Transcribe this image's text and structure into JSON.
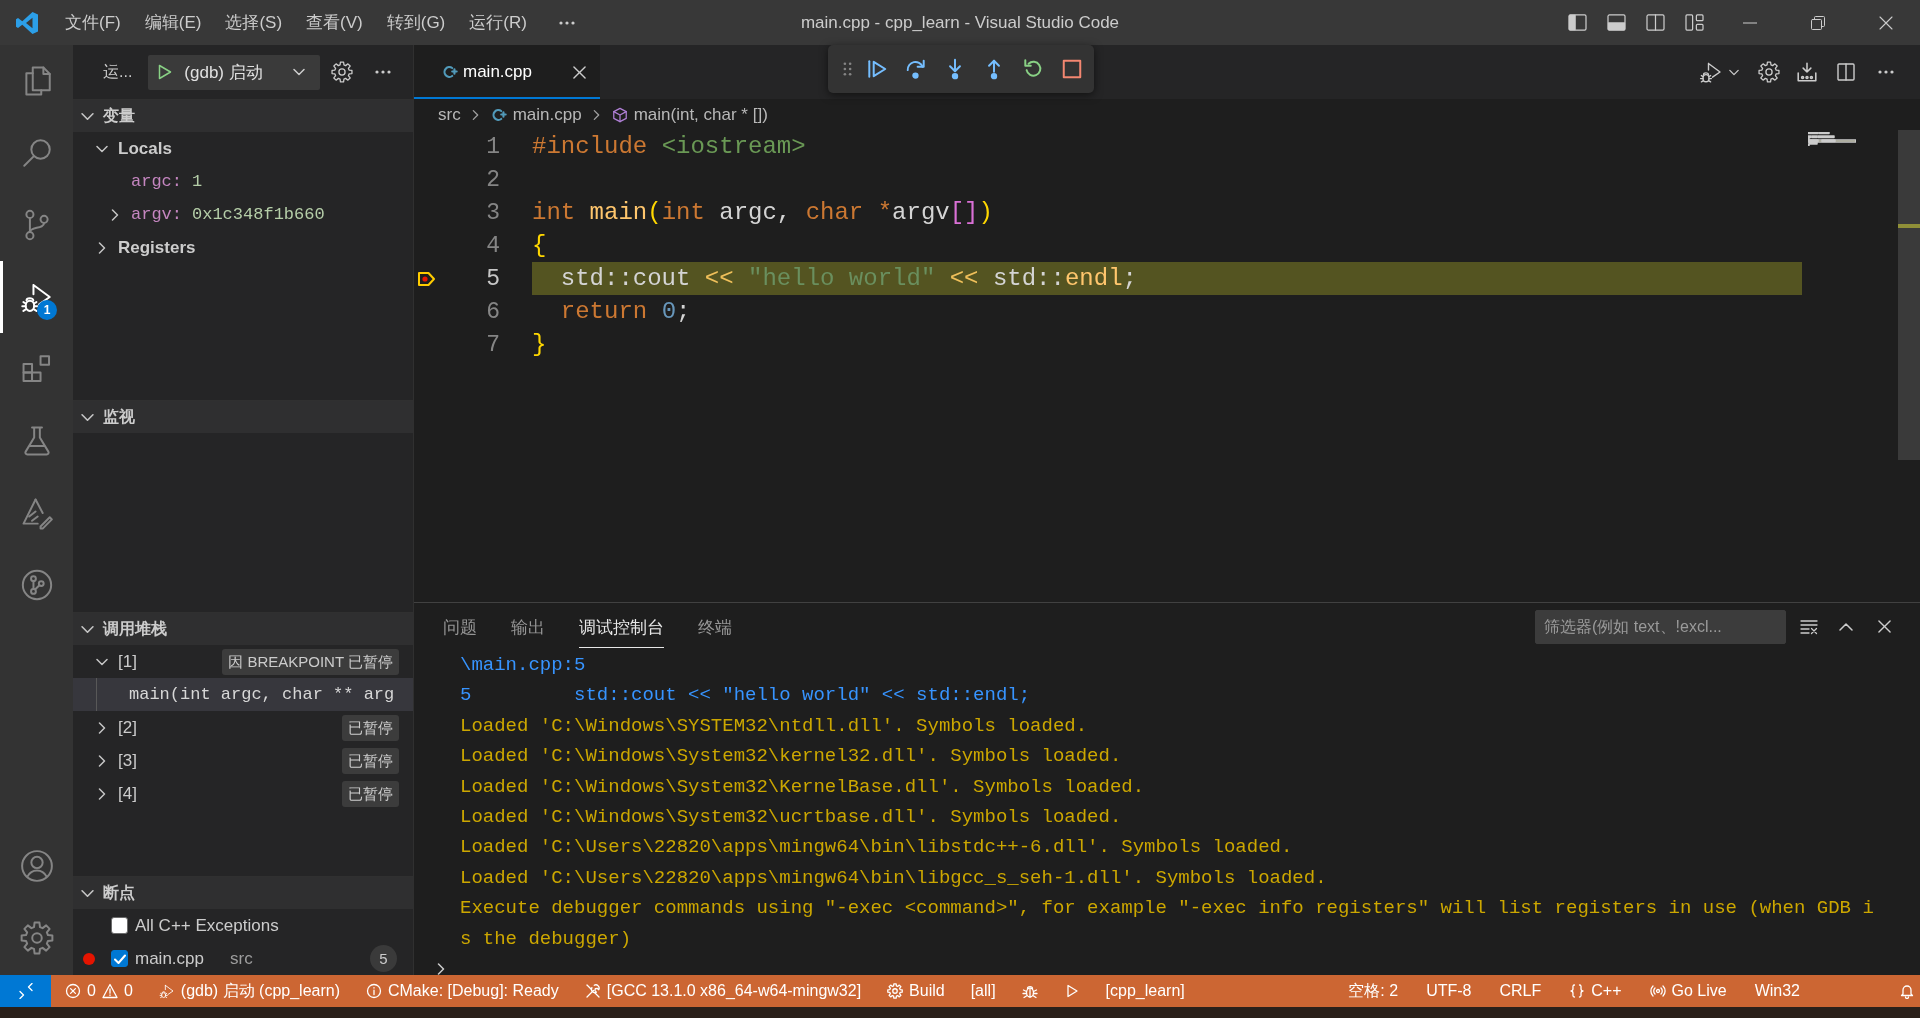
{
  "title_bar": {
    "menu": [
      "文件(F)",
      "编辑(E)",
      "选择(S)",
      "查看(V)",
      "转到(G)",
      "运行(R)"
    ],
    "title": "main.cpp - cpp_learn - Visual Studio Code"
  },
  "activity_bar": {
    "items": [
      {
        "selected": false
      },
      {
        "selected": false
      },
      {
        "selected": false
      },
      {
        "selected": true,
        "badge": "1"
      },
      {
        "selected": false
      },
      {
        "selected": false
      },
      {
        "selected": false
      },
      {
        "selected": false
      },
      {
        "selected": false
      },
      {
        "selected": false
      }
    ]
  },
  "sidebar": {
    "title": "运...",
    "launch_config": "(gdb) 启动",
    "variables": {
      "title": "变量",
      "expanded": true,
      "items": [
        {
          "kind": "scope",
          "label": "Locals",
          "expanded": true,
          "children": [
            {
              "kind": "variable",
              "name": "argc:",
              "value": "1"
            },
            {
              "kind": "variable",
              "name": "argv:",
              "value": "0x1c348f1b660",
              "expanded": false
            }
          ]
        },
        {
          "kind": "scope",
          "label": "Registers",
          "expanded": false
        }
      ]
    },
    "watch": {
      "title": "监视",
      "expanded": true
    },
    "call_stack": {
      "title": "调用堆栈",
      "expanded": true,
      "threads": [
        {
          "label": "[1]",
          "status": "因 BREAKPOINT 已暂停",
          "expanded": true,
          "frames": [
            {
              "label": "main(int argc, char ** arg",
              "selected": true
            }
          ]
        },
        {
          "label": "[2]",
          "status": "已暂停",
          "expanded": false
        },
        {
          "label": "[3]",
          "status": "已暂停",
          "expanded": false
        },
        {
          "label": "[4]",
          "status": "已暂停",
          "expanded": false
        }
      ]
    },
    "breakpoints": {
      "title": "断点",
      "expanded": true,
      "items": [
        {
          "kind": "exception",
          "label": "All C++ Exceptions",
          "checked": false
        },
        {
          "kind": "source",
          "label": "main.cpp",
          "checked": true,
          "path": "src",
          "line": "5"
        }
      ]
    }
  },
  "editor": {
    "tabs": [
      {
        "label": "main.cpp",
        "selected": true
      }
    ],
    "breadcrumbs": [
      {
        "kind": "folder",
        "label": "src"
      },
      {
        "kind": "file",
        "label": "main.cpp"
      },
      {
        "kind": "symbol",
        "label": "main(int, char * [])"
      }
    ],
    "lines": [
      {
        "number": "1",
        "current": false,
        "tokens": [
          {
            "text": "#include ",
            "kind": "directive"
          },
          {
            "text": "<iostream>",
            "kind": "header"
          }
        ]
      },
      {
        "number": "2",
        "current": false
      },
      {
        "number": "3",
        "current": false,
        "tokens": [
          {
            "text": "int ",
            "kind": "keyword"
          },
          {
            "text": "main",
            "kind": "function"
          },
          {
            "text": "(",
            "kind": "bracket"
          },
          {
            "text": "int ",
            "kind": "keyword"
          },
          {
            "text": "argc, ",
            "kind": "plain"
          },
          {
            "text": "char ",
            "kind": "keyword"
          },
          {
            "text": "*",
            "kind": "keyword"
          },
          {
            "text": "argv",
            "kind": "plain"
          },
          {
            "text": "[]",
            "kind": "bracket2"
          },
          {
            "text": ")",
            "kind": "bracket"
          }
        ]
      },
      {
        "number": "4",
        "current": false,
        "tokens": [
          {
            "text": "{",
            "kind": "bracket"
          }
        ]
      },
      {
        "number": "5",
        "current": true,
        "tokens": [
          {
            "text": "  std::cout ",
            "kind": "plain"
          },
          {
            "text": "<< ",
            "kind": "operator"
          },
          {
            "text": "\"hello world\" ",
            "kind": "string"
          },
          {
            "text": "<< ",
            "kind": "operator"
          },
          {
            "text": "std::",
            "kind": "plain"
          },
          {
            "text": "endl",
            "kind": "function"
          },
          {
            "text": ";",
            "kind": "plain"
          }
        ]
      },
      {
        "number": "6",
        "current": false,
        "tokens": [
          {
            "text": "  return ",
            "kind": "keyword"
          },
          {
            "text": "0",
            "kind": "number"
          },
          {
            "text": ";",
            "kind": "plain"
          }
        ]
      },
      {
        "number": "7",
        "current": false,
        "tokens": [
          {
            "text": "}",
            "kind": "bracket"
          }
        ]
      }
    ]
  },
  "panel": {
    "tabs": [
      {
        "label": "问题",
        "selected": false
      },
      {
        "label": "输出",
        "selected": false
      },
      {
        "label": "调试控制台",
        "selected": true
      },
      {
        "label": "终端",
        "selected": false
      }
    ],
    "filter": {
      "placeholder": "筛选器(例如 text、!excl..."
    },
    "console": [
      {
        "kind": "source",
        "text": "\\main.cpp:5"
      },
      {
        "kind": "source",
        "text": "5         std::cout << \"hello world\" << std::endl;"
      },
      {
        "kind": "log",
        "text": "Loaded 'C:\\Windows\\SYSTEM32\\ntdll.dll'. Symbols loaded."
      },
      {
        "kind": "log",
        "text": "Loaded 'C:\\Windows\\System32\\kernel32.dll'. Symbols loaded."
      },
      {
        "kind": "log",
        "text": "Loaded 'C:\\Windows\\System32\\KernelBase.dll'. Symbols loaded."
      },
      {
        "kind": "log",
        "text": "Loaded 'C:\\Windows\\System32\\ucrtbase.dll'. Symbols loaded."
      },
      {
        "kind": "log",
        "text": "Loaded 'C:\\Users\\22820\\apps\\mingw64\\bin\\libstdc++-6.dll'. Symbols loaded."
      },
      {
        "kind": "log",
        "text": "Loaded 'C:\\Users\\22820\\apps\\mingw64\\bin\\libgcc_s_seh-1.dll'. Symbols loaded."
      },
      {
        "kind": "log",
        "text": "Execute debugger commands using \"-exec <command>\", for example \"-exec info registers\" will list registers in use (when GDB is the debugger)"
      }
    ]
  },
  "status_bar": {
    "debugging": true,
    "problems": {
      "errors": "0",
      "warnings": "0"
    },
    "debug_config": "(gdb) 启动 (cpp_learn)",
    "cmake_status": "CMake: [Debug]: Ready",
    "kit": "[GCC 13.1.0 x86_64-w64-mingw32]",
    "build": "Build",
    "build_target": "[all]",
    "launch_target": "[cpp_learn]",
    "indentation": "空格: 2",
    "encoding": "UTF-8",
    "eol": "CRLF",
    "language": "C++",
    "live_server": "Go Live",
    "platform": "Win32"
  }
}
